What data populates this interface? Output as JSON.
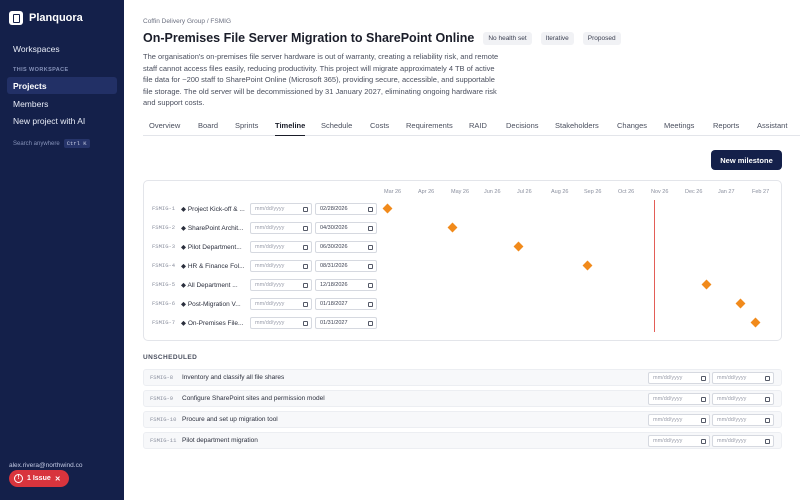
{
  "brand": {
    "name": "Planquora"
  },
  "sidebar": {
    "workspaces_label": "Workspaces",
    "section_label": "THIS WORKSPACE",
    "items": [
      {
        "label": "Projects",
        "active": true
      },
      {
        "label": "Members"
      },
      {
        "label": "New project with AI"
      }
    ],
    "search_hint": "Search anywhere",
    "search_shortcut": "Ctrl K",
    "user_email": "alex.rivera@northwind.co",
    "issue_badge": "1 Issue"
  },
  "header": {
    "breadcrumb": "Coffin Delivery Group / FSMIG",
    "title": "On-Premises File Server Migration to SharePoint Online",
    "tags": [
      "No health set",
      "Iterative",
      "Proposed"
    ],
    "description": "The organisation's on-premises file server hardware is out of warranty, creating a reliability risk, and remote staff cannot access files easily, reducing productivity. This project will migrate approximately 4 TB of active file data for ~200 staff to SharePoint Online (Microsoft 365), providing secure, accessible, and supportable file storage. The old server will be decommissioned by 31 January 2027, eliminating ongoing hardware risk and support costs."
  },
  "tabs": [
    "Overview",
    "Board",
    "Sprints",
    "Timeline",
    "Schedule",
    "Costs",
    "Requirements",
    "RAID",
    "Decisions",
    "Stakeholders",
    "Changes",
    "Meetings",
    "Reports",
    "Assistant"
  ],
  "active_tab": "Timeline",
  "buttons": {
    "new_milestone": "New milestone"
  },
  "timeline": {
    "months": [
      "Mar 26",
      "Apr 26",
      "May 26",
      "Jun 26",
      "Jul 26",
      "Aug 26",
      "Sep 26",
      "Oct 26",
      "Nov 26",
      "Dec 26",
      "Jan 27",
      "Feb 27"
    ],
    "date_placeholder": "mm/dd/yyyy",
    "milestones": [
      {
        "id": "FSMIG-1",
        "name": "Project Kick-off & ...",
        "start": "",
        "due": "02/28/2026"
      },
      {
        "id": "FSMIG-2",
        "name": "SharePoint Archit...",
        "start": "",
        "due": "04/30/2026"
      },
      {
        "id": "FSMIG-3",
        "name": "Pilot Department...",
        "start": "",
        "due": "06/30/2026"
      },
      {
        "id": "FSMIG-4",
        "name": "HR & Finance Fol...",
        "start": "",
        "due": "08/31/2026"
      },
      {
        "id": "FSMIG-5",
        "name": "All Department ...",
        "start": "",
        "due": "12/18/2026"
      },
      {
        "id": "FSMIG-6",
        "name": "Post-Migration V...",
        "start": "",
        "due": "01/18/2027"
      },
      {
        "id": "FSMIG-7",
        "name": "On-Premises File...",
        "start": "",
        "due": "01/31/2027"
      }
    ],
    "today_date": "11/01/2026"
  },
  "unscheduled": {
    "title": "UNSCHEDULED",
    "items": [
      {
        "id": "FSMIG-8",
        "name": "Inventory and classify all file shares"
      },
      {
        "id": "FSMIG-9",
        "name": "Configure SharePoint sites and permission model"
      },
      {
        "id": "FSMIG-10",
        "name": "Procure and set up migration tool"
      },
      {
        "id": "FSMIG-11",
        "name": "Pilot department migration"
      }
    ]
  },
  "colors": {
    "sidebar": "#14204a",
    "accent": "#14204a",
    "milestone": "#f18a1b",
    "today": "#e35d57",
    "issue": "#d8343d"
  }
}
